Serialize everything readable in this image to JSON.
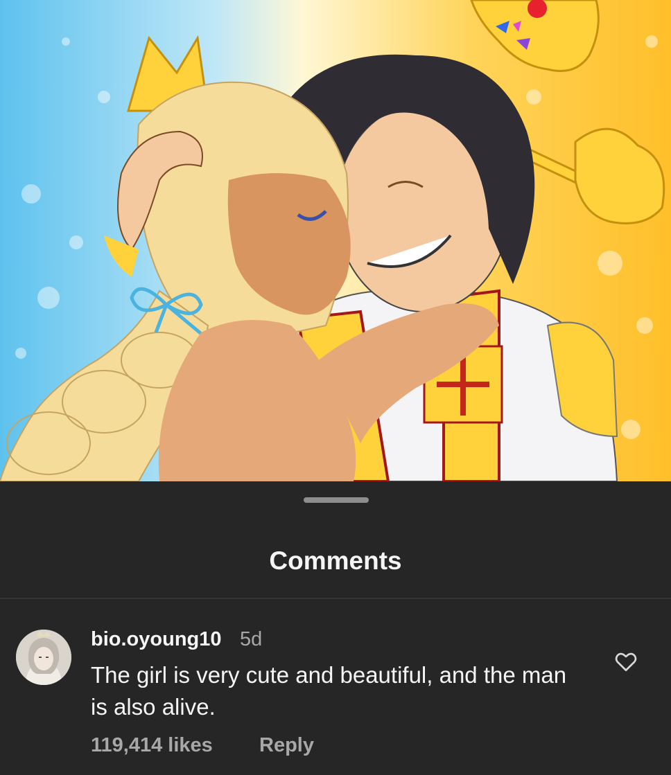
{
  "post": {
    "image_description_icon": "illustration-icon",
    "colors": {
      "sky_blue": "#5ec2ee",
      "gold": "#ffc83a",
      "hair_blonde": "#f6dc9a",
      "hair_black": "#2f2d33",
      "skin_tan": "#e5a878",
      "skin_light": "#f4c9a0"
    }
  },
  "sheet": {
    "title": "Comments",
    "background": "#262626"
  },
  "comment": {
    "username": "bio.oyoung10",
    "time": "5d",
    "text": "The girl is very cute and beautiful, and the man is also alive.",
    "likes": "119,414 likes",
    "reply_label": "Reply",
    "like_icon": "heart-outline-icon",
    "avatar_icon": "avatar"
  }
}
